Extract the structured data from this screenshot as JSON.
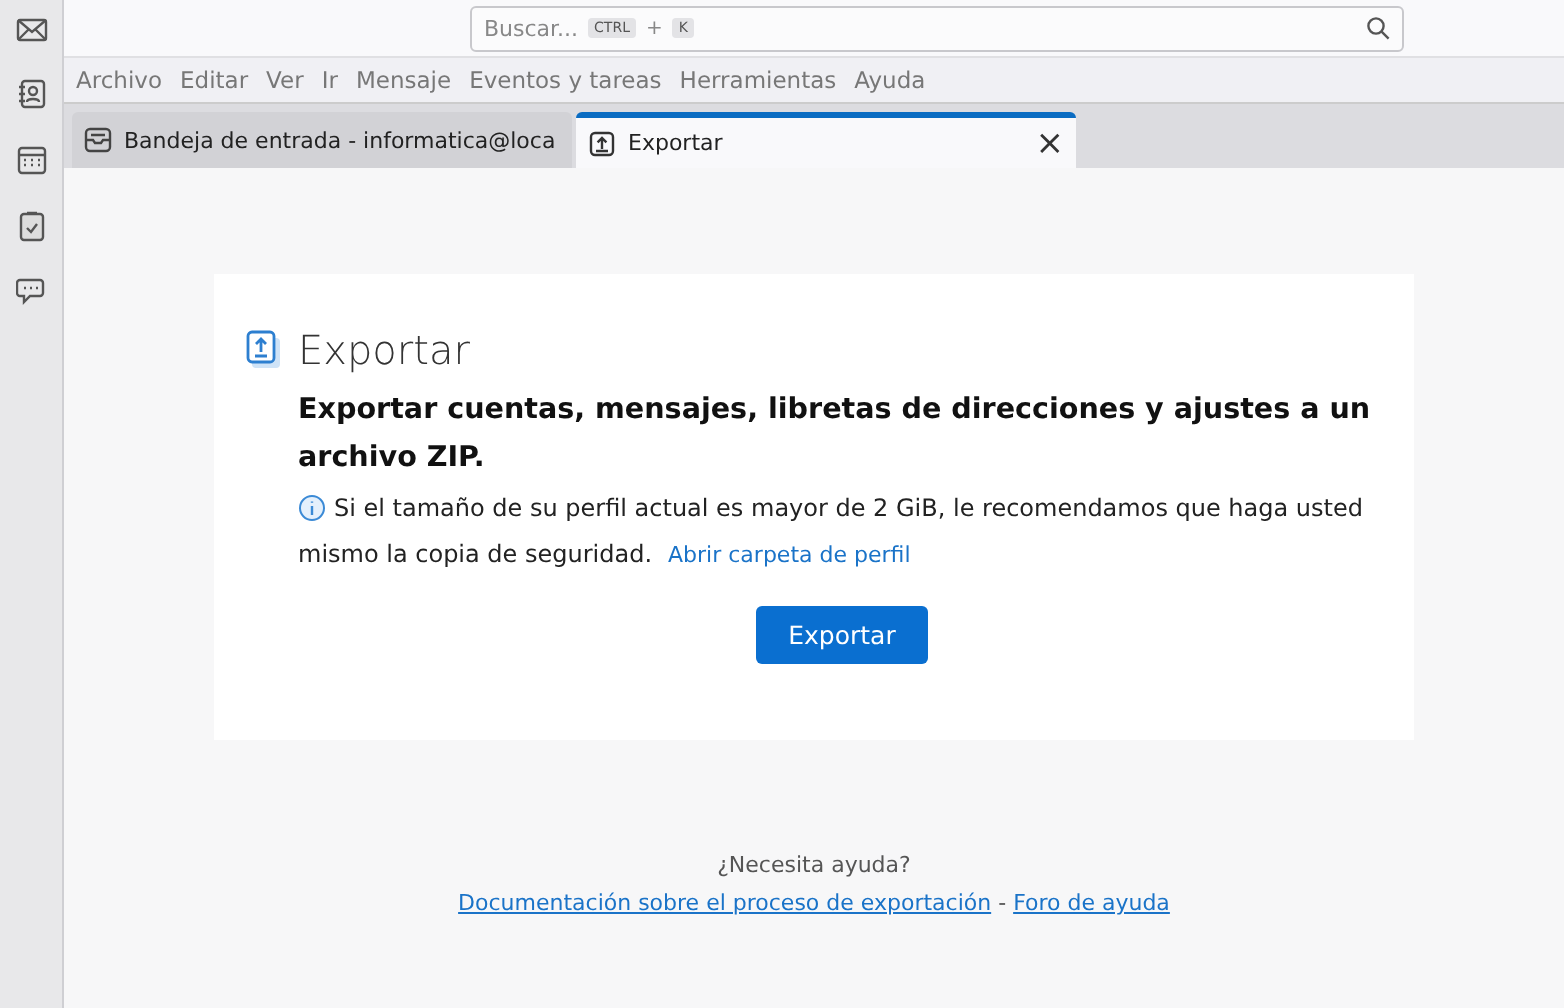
{
  "spaces": [
    {
      "kind": "mail"
    },
    {
      "kind": "contacts"
    },
    {
      "kind": "calendar"
    },
    {
      "kind": "tasks"
    },
    {
      "kind": "chat"
    }
  ],
  "search": {
    "placeholder": "Buscar...",
    "keys": [
      "CTRL",
      "K"
    ],
    "joiner": "+"
  },
  "menu": [
    "Archivo",
    "Editar",
    "Ver",
    "Ir",
    "Mensaje",
    "Eventos y tareas",
    "Herramientas",
    "Ayuda"
  ],
  "tabs": [
    {
      "kind": "inbox",
      "label": "Bandeja de entrada - informatica@loca",
      "selected": false
    },
    {
      "kind": "export",
      "label": "Exportar",
      "selected": true,
      "close": "×"
    }
  ],
  "page": {
    "title": "Exportar",
    "heading": "Exportar cuentas, mensajes, libretas de direcciones y ajustes a un archivo ZIP.",
    "note": "Si el tamaño de su perfil actual es mayor de 2 GiB, le recomendamos que haga usted mismo la copia de seguridad.",
    "link": "Abrir carpeta de perfil",
    "button": "Exportar"
  },
  "help": {
    "question": "¿Necesita ayuda?",
    "links": [
      "Documentación sobre el proceso de exportación",
      "Foro de ayuda"
    ],
    "separator": "-"
  }
}
